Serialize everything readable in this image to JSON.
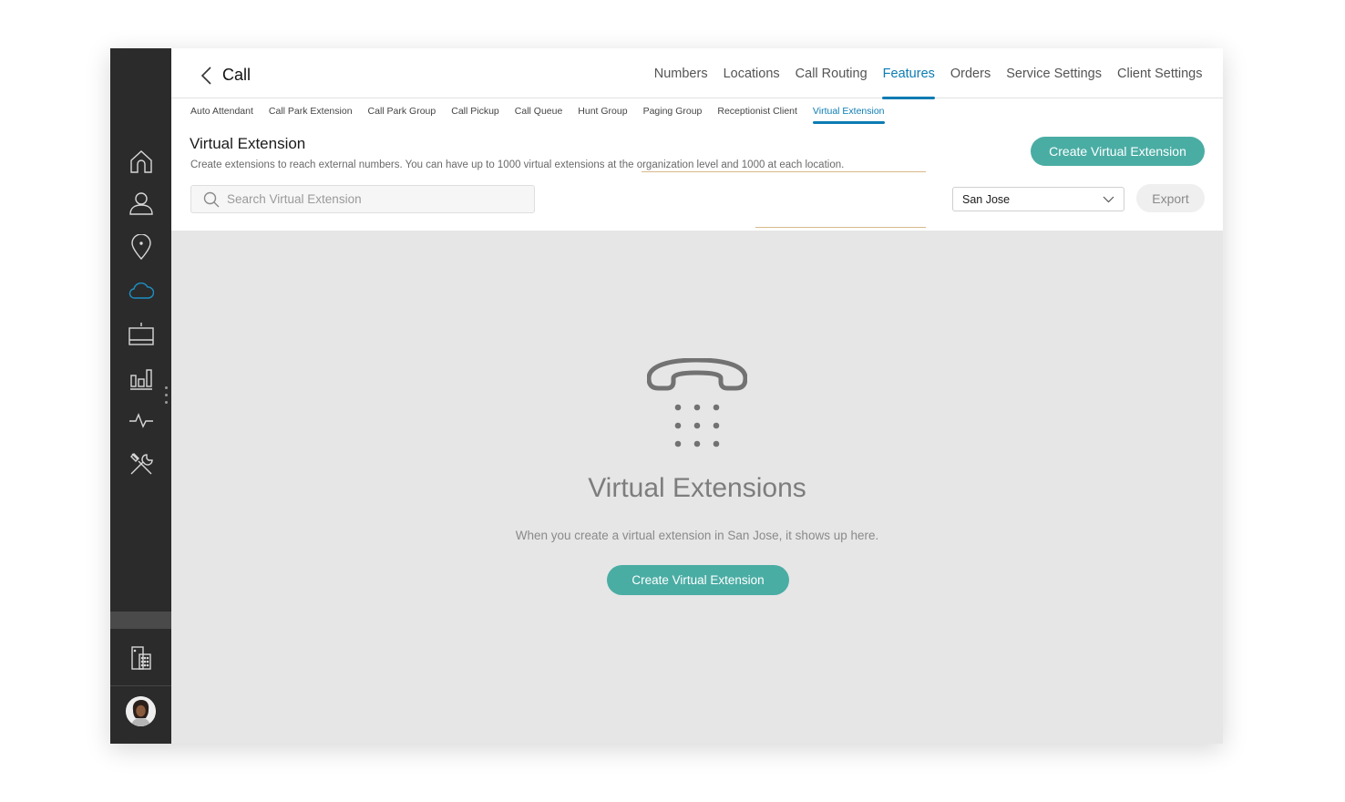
{
  "app": {
    "title": "Call"
  },
  "top_nav": [
    {
      "label": "Numbers",
      "active": false
    },
    {
      "label": "Locations",
      "active": false
    },
    {
      "label": "Call Routing",
      "active": false
    },
    {
      "label": "Features",
      "active": true
    },
    {
      "label": "Orders",
      "active": false
    },
    {
      "label": "Service Settings",
      "active": false
    },
    {
      "label": "Client Settings",
      "active": false
    }
  ],
  "sub_nav": [
    {
      "label": "Auto Attendant",
      "active": false
    },
    {
      "label": "Call Park Extension",
      "active": false
    },
    {
      "label": "Call Park Group",
      "active": false
    },
    {
      "label": "Call Pickup",
      "active": false
    },
    {
      "label": "Call Queue",
      "active": false
    },
    {
      "label": "Hunt Group",
      "active": false
    },
    {
      "label": "Paging Group",
      "active": false
    },
    {
      "label": "Receptionist Client",
      "active": false
    },
    {
      "label": "Virtual Extension",
      "active": true
    }
  ],
  "page": {
    "title": "Virtual Extension",
    "description": "Create extensions to reach external numbers. You can have up to 1000 virtual extensions at the organization level and 1000 at each location.",
    "create_button": "Create Virtual Extension",
    "search_placeholder": "Search Virtual Extension",
    "location_select": "San Jose",
    "export_button": "Export"
  },
  "empty_state": {
    "title": "Virtual Extensions",
    "description": "When you create a virtual extension in San Jose, it shows up here.",
    "button": "Create Virtual Extension"
  },
  "rail": {
    "icons": [
      "home-icon",
      "user-icon",
      "location-pin-icon",
      "cloud-icon",
      "devices-icon",
      "analytics-icon",
      "activity-icon",
      "tools-icon"
    ],
    "active": "cloud-icon",
    "bottom_icons": [
      "building-icon"
    ]
  },
  "colors": {
    "rail_bg": "#2b2b2b",
    "accent": "#0c7cb3",
    "primary_button": "#4aada4",
    "content_bg": "#e6e6e6"
  }
}
